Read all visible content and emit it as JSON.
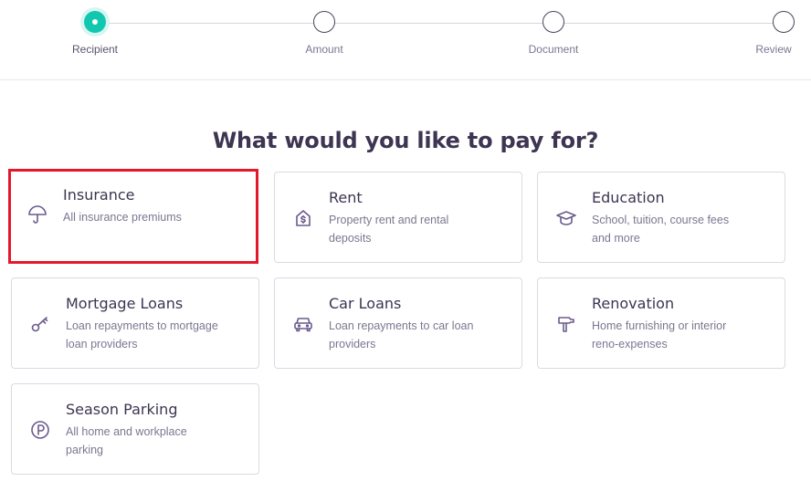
{
  "stepper": {
    "steps": [
      {
        "label": "Recipient",
        "state": "active"
      },
      {
        "label": "Amount",
        "state": "pending"
      },
      {
        "label": "Document",
        "state": "pending"
      },
      {
        "label": "Review",
        "state": "pending"
      }
    ],
    "accent_color": "#12c7b0"
  },
  "page": {
    "title": "What would you like to pay for?"
  },
  "categories": [
    {
      "title": "Insurance",
      "description": "All insurance premiums",
      "icon": "umbrella-icon",
      "selected": true
    },
    {
      "title": "Rent",
      "description": "Property rent and rental deposits",
      "icon": "house-dollar-icon"
    },
    {
      "title": "Education",
      "description": "School, tuition, course fees and more",
      "icon": "graduation-cap-icon"
    },
    {
      "title": "Mortgage Loans",
      "description": "Loan repayments to mortgage loan providers",
      "icon": "key-icon"
    },
    {
      "title": "Car Loans",
      "description": "Loan repayments to car loan providers",
      "icon": "car-icon"
    },
    {
      "title": "Renovation",
      "description": "Home furnishing or interior reno-expenses",
      "icon": "hammer-icon"
    },
    {
      "title": "Season Parking",
      "description": "All home and workplace parking",
      "icon": "parking-icon"
    }
  ],
  "colors": {
    "highlight_border": "#e4182a",
    "icon": "#6b5a8e",
    "text": "#3d3551"
  }
}
